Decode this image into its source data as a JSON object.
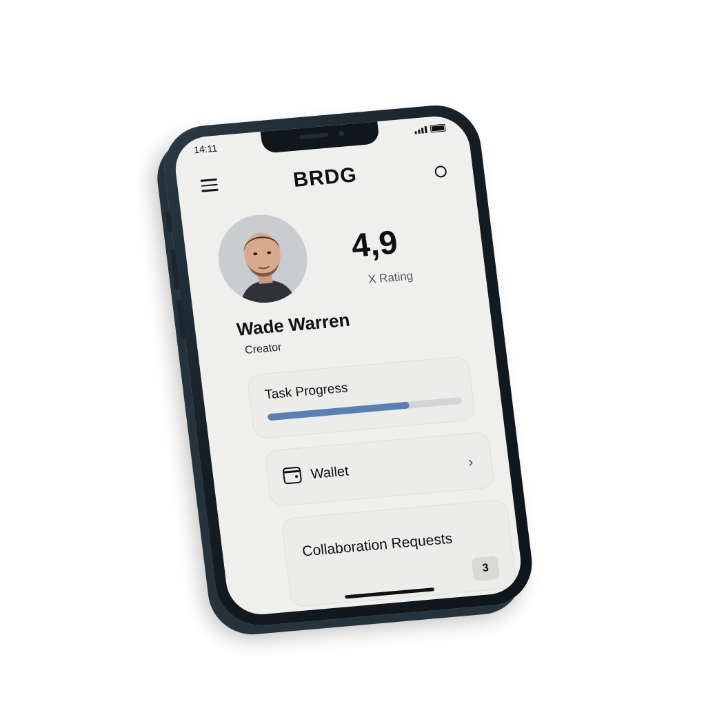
{
  "status_bar": {
    "time": "14:11"
  },
  "header": {
    "brand": "BRDG",
    "menu_icon": "hamburger-menu-icon",
    "right_icon": "circle-icon"
  },
  "profile": {
    "name": "Wade Warren",
    "role": "Creator",
    "rating_value": "4,9",
    "rating_label": "X Rating"
  },
  "task_progress": {
    "title": "Task Progress",
    "progress_fraction": 0.73,
    "fill_color": "#5b7fb0"
  },
  "wallet": {
    "label": "Wallet",
    "icon": "wallet-icon",
    "chevron_icon": "chevron-right-icon"
  },
  "collaboration": {
    "label": "Collaboration Requests",
    "count": "3"
  }
}
